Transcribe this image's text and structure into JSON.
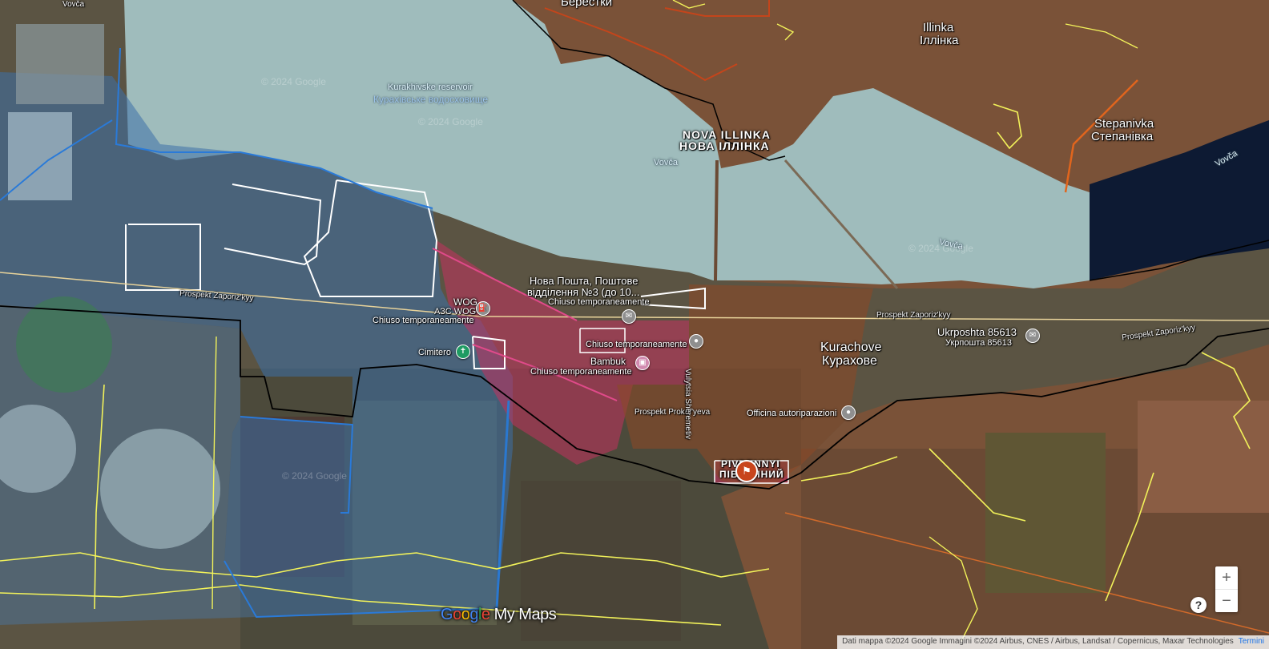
{
  "map": {
    "places": {
      "berestky": "Берестки",
      "vovcha_top": "Vovča",
      "illinka_lat": "Illinka",
      "illinka_cyr": "Іллінка",
      "stepanivka_lat": "Stepanivka",
      "stepanivka_cyr": "Степанівка",
      "nova_illinka_lat": "NOVA ILLINKA",
      "nova_illinka_cyr": "НОВА ІЛЛІНКА",
      "kurachove_lat": "Kurachove",
      "kurachove_cyr": "Курахове",
      "pivdennyi_lat": "PIVDENNYI",
      "pivdennyi_cyr": "ПІВДЕННИЙ"
    },
    "water": {
      "reservoir_lat": "Kurakhivske reservoir",
      "reservoir_cyr": "Курахівське водосховище",
      "vovca_1": "Vovča",
      "vovca_2": "Vovča",
      "vovca_3": "Vovča"
    },
    "streets": {
      "zaporizkyy_1": "Prospekt Zaporiz'kyy",
      "zaporizkyy_2": "Prospekt Zaporiz'kyy",
      "zaporizkyy_3": "Prospekt Zaporiz'kyy",
      "prokofyeva": "Prospekt Prokof'yeva",
      "vulytsia": "Vulytsia Sheremetiv"
    },
    "pois": {
      "nova_poshta_1": "Нова Пошта, Поштове",
      "nova_poshta_2": "відділення №3 (до 10...",
      "nova_poshta_closed": "Chiuso temporaneamente",
      "wog_1": "WOG",
      "wog_2": "АЗС WOG",
      "wog_closed": "Chiuso temporaneamente",
      "cimitero": "Cimitero",
      "poi_closed_1": "Chiuso temporaneamente",
      "bambuk": "Bambuk",
      "bambuk_closed": "Chiuso temporaneamente",
      "ukrposhta_lat": "Ukrposhta 85613",
      "ukrposhta_cyr": "Укрпошта 85613",
      "officina": "Officina autoriparazioni"
    },
    "watermarks": [
      "© 2024 Google",
      "© 2024 Google",
      "© 2024 Google",
      "© 2024 Google"
    ]
  },
  "controls": {
    "zoom_in": "+",
    "zoom_out": "−",
    "help": "?"
  },
  "branding": {
    "google_letters": [
      "G",
      "o",
      "o",
      "g",
      "l",
      "e"
    ],
    "my_maps": " My Maps"
  },
  "attribution": {
    "text": "Dati mappa ©2024 Google Immagini ©2024 Airbus, CNES / Airbus, Landsat / Copernicus, Maxar Technologies",
    "terms": "Termini"
  },
  "colors": {
    "reservoir": "#9fbcbc",
    "dark_water": "#0d1a33",
    "terrain": "#6e4a33",
    "occupied_zone": "#8a4a28",
    "contested_zone": "#c2315f",
    "controlled_zone": "#3c6fa8",
    "frontline": "#000000",
    "trench_lines": "#f2f25a",
    "marker_flag": "#c8451d"
  }
}
